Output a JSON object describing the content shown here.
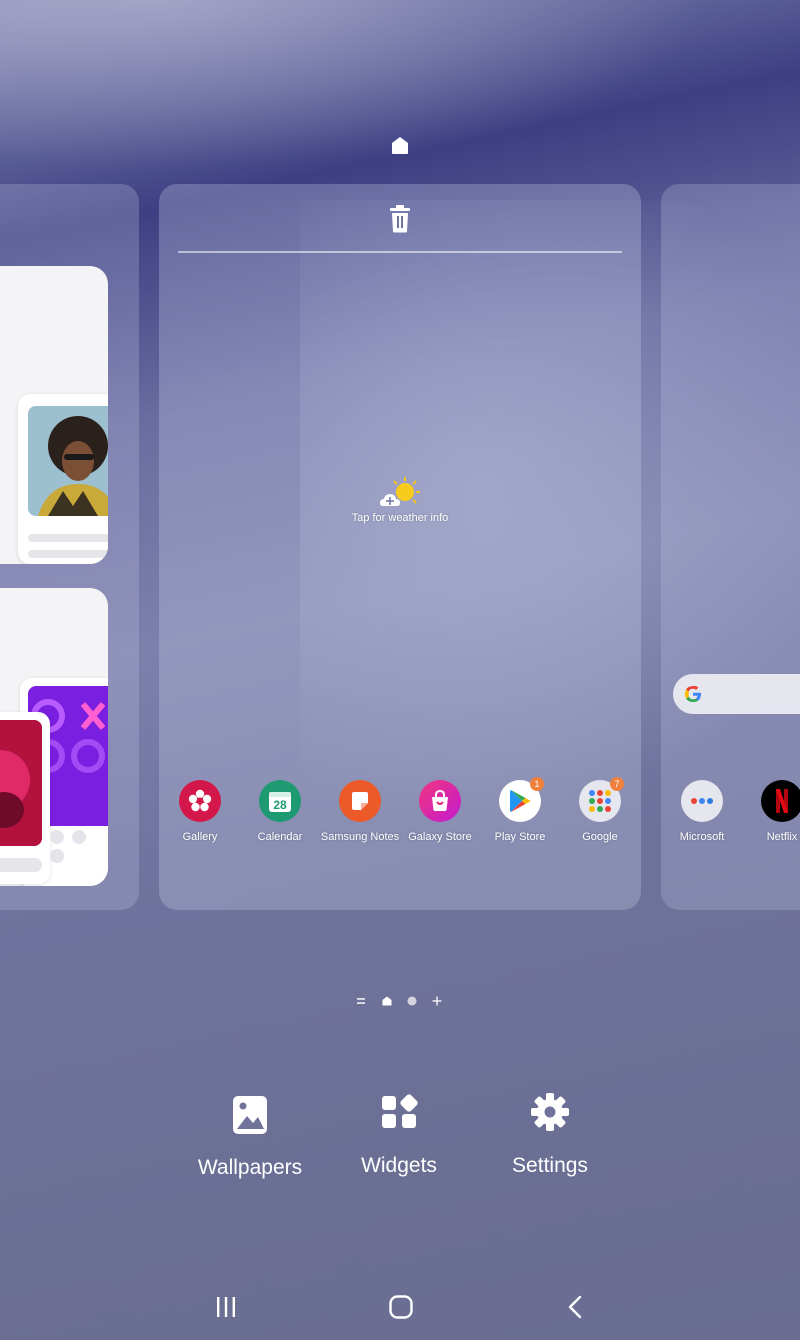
{
  "weather": {
    "label": "Tap for weather info"
  },
  "apps": [
    {
      "label": "Gallery",
      "icon": "gallery-icon",
      "color": "#d4174a"
    },
    {
      "label": "Calendar",
      "icon": "calendar-icon",
      "color": "#1e9a73",
      "date": "28"
    },
    {
      "label": "Samsung Notes",
      "icon": "notes-icon",
      "color": "#ec5a2a"
    },
    {
      "label": "Galaxy Store",
      "icon": "store-icon",
      "color": "#e6247a"
    },
    {
      "label": "Play Store",
      "icon": "play-icon",
      "color": "#ffffff",
      "badge": "1"
    },
    {
      "label": "Google",
      "icon": "folder-icon",
      "color": "#e9e9ee",
      "badge": "7"
    }
  ],
  "right_apps": [
    {
      "label": "Microsoft",
      "icon": "folder-icon",
      "color": "#e9e9ee"
    },
    {
      "label": "Netflix",
      "icon": "netflix-icon",
      "color": "#000000"
    }
  ],
  "toolbar": {
    "wallpapers": "Wallpapers",
    "widgets": "Widgets",
    "settings": "Settings"
  },
  "colors": {
    "accent_badge": "#f0803c"
  }
}
